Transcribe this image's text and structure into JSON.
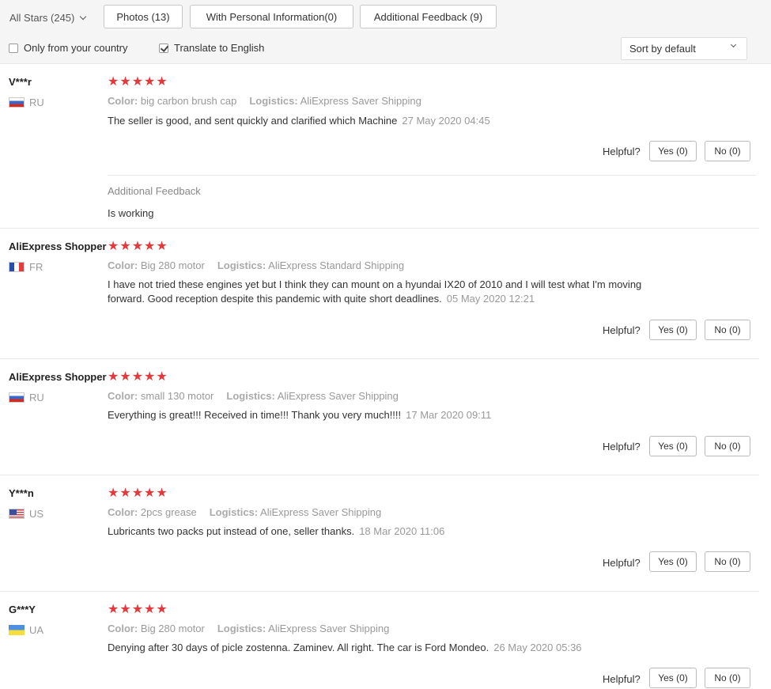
{
  "filters": {
    "all_stars": "All Stars (245)",
    "photos": "Photos (13)",
    "personal": "With Personal Information(0)",
    "additional": "Additional Feedback (9)",
    "only_country": "Only from your country",
    "only_country_checked": false,
    "translate": "Translate to English",
    "translate_checked": true,
    "sort": "Sort by default"
  },
  "labels": {
    "color": "Color:",
    "logistics": "Logistics:",
    "helpful": "Helpful?",
    "additional_feedback": "Additional Feedback"
  },
  "reviews": [
    {
      "user": "V***r",
      "country": "RU",
      "stars": 5,
      "color": "big carbon brush cap",
      "logistics": "AliExpress Saver Shipping",
      "text": "The seller is good, and sent quickly and clarified which Machine",
      "date": "27 May 2020 04:45",
      "yes": "Yes (0)",
      "no": "No (0)",
      "additional_text": "Is working"
    },
    {
      "user": "AliExpress Shopper",
      "country": "FR",
      "stars": 5,
      "color": "Big 280 motor",
      "logistics": "AliExpress Standard Shipping",
      "text_line1": "I have not tried these engines yet but I think they can mount on a hyundai IX20 of 2010 and I will test what I'm moving",
      "text_line2": "forward. Good reception despite this pandemic with quite short deadlines.",
      "date": "05 May 2020 12:21",
      "yes": "Yes (0)",
      "no": "No (0)"
    },
    {
      "user": "AliExpress Shopper",
      "country": "RU",
      "stars": 5,
      "color": "small 130 motor",
      "logistics": "AliExpress Saver Shipping",
      "text": "Everything is great!!! Received in time!!! Thank you very much!!!!",
      "date": "17 Mar 2020 09:11",
      "yes": "Yes (0)",
      "no": "No (0)"
    },
    {
      "user": "Y***n",
      "country": "US",
      "stars": 5,
      "color": "2pcs grease",
      "logistics": "AliExpress Saver Shipping",
      "text": "Lubricants two packs put instead of one, seller thanks.",
      "date": "18 Mar 2020 11:06",
      "yes": "Yes (0)",
      "no": "No (0)"
    },
    {
      "user": "G***Y",
      "country": "UA",
      "stars": 5,
      "color": "Big 280 motor",
      "logistics": "AliExpress Saver Shipping",
      "text": "Denying after 30 days of picle zostenna. Zaminev. All right. The car is Ford Mondeo.",
      "date": "26 May 2020 05:36",
      "yes": "Yes (0)",
      "no": "No (0)"
    }
  ]
}
